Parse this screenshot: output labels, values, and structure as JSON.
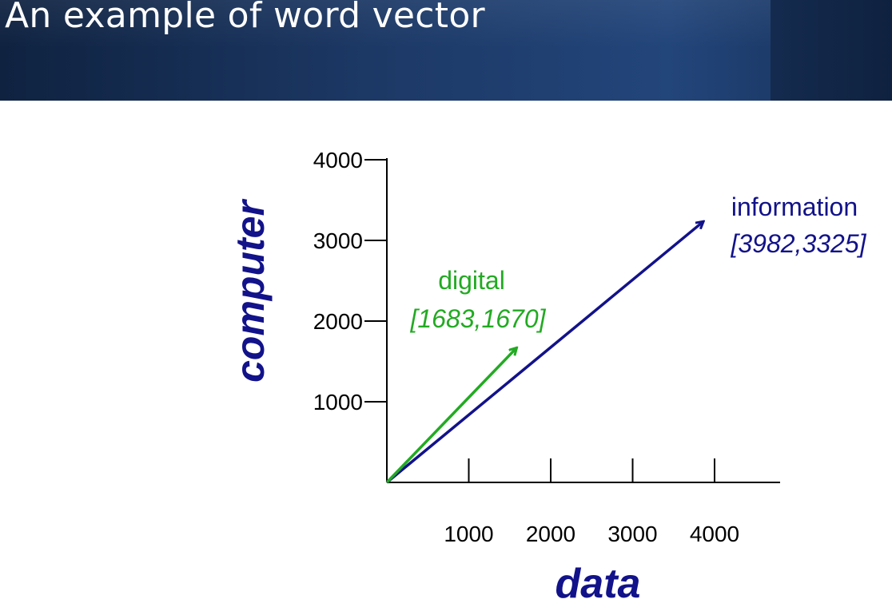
{
  "slide": {
    "title": "An example of word vector"
  },
  "colors": {
    "title_bar": "#1d3a68",
    "axis": "#000000",
    "navy": "#12128a",
    "green": "#22aa22"
  },
  "chart_data": {
    "type": "vector",
    "xlabel": "data",
    "ylabel": "computer",
    "x_ticks": [
      "1000",
      "2000",
      "3000",
      "4000"
    ],
    "y_ticks": [
      "1000",
      "2000",
      "3000",
      "4000"
    ],
    "xlim": [
      0,
      4800
    ],
    "ylim": [
      0,
      4000
    ],
    "grid": false,
    "vectors": [
      {
        "name": "information",
        "coords_label": "[3982,3325]",
        "x": 3982,
        "y": 3325,
        "color": "#12128a"
      },
      {
        "name": "digital",
        "coords_label": "[1683,1670]",
        "x": 1683,
        "y": 1670,
        "color": "#22aa22"
      }
    ]
  }
}
